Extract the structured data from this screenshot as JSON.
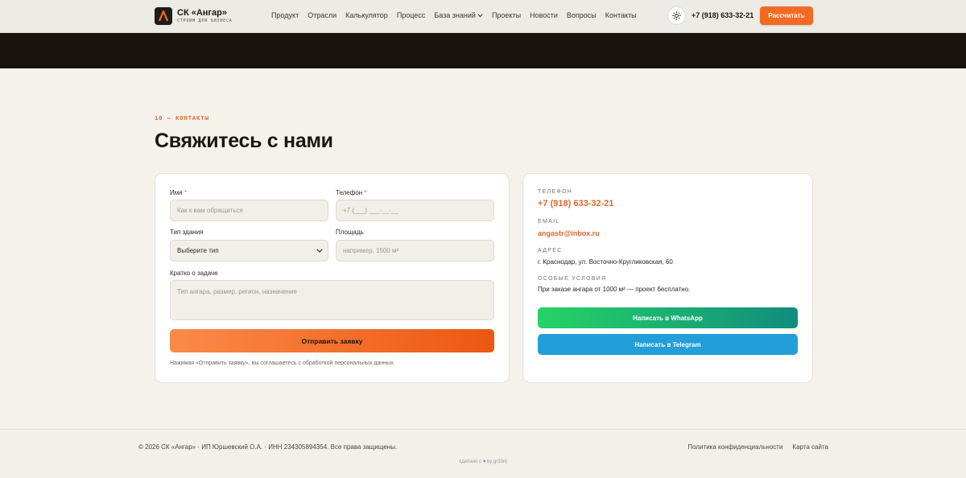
{
  "header": {
    "brand_title": "СК «Ангар»",
    "brand_subtitle": "СТРОИМ ДЛЯ БИЗНЕСА",
    "nav": [
      "Продукт",
      "Отрасли",
      "Калькулятор",
      "Процесс",
      "База знаний",
      "Проекты",
      "Новости",
      "Вопросы",
      "Контакты"
    ],
    "phone": "+7 (918) 633-32-21",
    "cta_label": "Рассчитать",
    "accent_color": "#f36b22"
  },
  "section": {
    "eyebrow": "10 — КОНТАКТЫ",
    "title": "Свяжитесь с нами"
  },
  "form": {
    "name_label": "Имя",
    "name_placeholder": "Как к вам обращаться",
    "phone_label": "Телефон",
    "phone_placeholder": "+7 (___) ___-__-__",
    "building_label": "Тип здания",
    "building_selected": "Выберите тип",
    "area_label": "Площадь",
    "area_placeholder": "например, 1500 м²",
    "task_label": "Кратко о задаче",
    "task_placeholder": "Тип ангара, размер, регион, назначение",
    "required_mark": "*",
    "submit_label": "Отправить заявку",
    "disclaimer": "Нажимая «Отправить заявку», вы соглашаетесь с обработкой персональных данных."
  },
  "info": {
    "phone_label": "ТЕЛЕФОН",
    "phone_value": "+7 (918) 633-32-21",
    "email_label": "EMAIL",
    "email_value": "angastr@inbox.ru",
    "address_label": "АДРЕС",
    "address_value": "г. Краснодар, ул. Восточно-Кругликовская, 60",
    "terms_label": "ОСОБЫЕ УСЛОВИЯ",
    "terms_value": "При заказе ангара от 1000 м² — проект бесплатно.",
    "whatsapp_label": "Написать в WhatsApp",
    "telegram_label": "Написать в Telegram"
  },
  "footer": {
    "copyright": "© 2026 СК «Ангар» · ИП Юршевский О.А. · ИНН 234305894354. Все права защищены.",
    "privacy_link": "Политика конфиденциальности",
    "sitemap_link": "Карта сайта",
    "made_prefix": "сделано с",
    "made_suffix": "by gr33nj"
  }
}
